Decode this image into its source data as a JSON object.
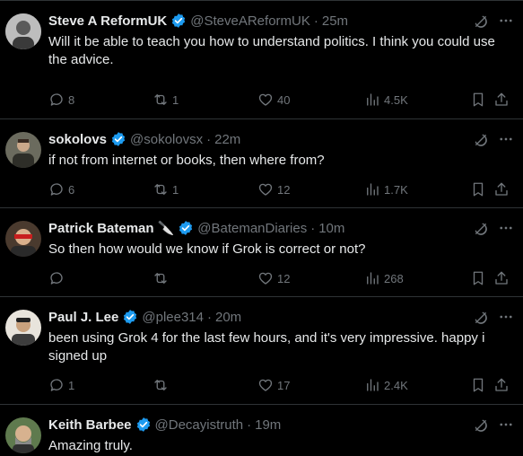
{
  "colors": {
    "background": "#000000",
    "text": "#e7e9ea",
    "muted": "#71767b",
    "verified": "#1d9bf0",
    "divider": "#2f3336"
  },
  "tweets": [
    {
      "name": "Steve A ReformUK",
      "handle": "@SteveAReformUK",
      "time": "25m",
      "text": "Will it be able to teach you how to understand politics. I think you could use the advice.",
      "replies": "8",
      "reposts": "1",
      "likes": "40",
      "views": "4.5K"
    },
    {
      "name": "sokolovs",
      "handle": "@sokolovsx",
      "time": "22m",
      "text": "if not from internet or books, then where from?",
      "replies": "6",
      "reposts": "1",
      "likes": "12",
      "views": "1.7K"
    },
    {
      "name": "Patrick Bateman",
      "name_emoji": "🔪",
      "handle": "@BatemanDiaries",
      "time": "10m",
      "text": "So then how would we know if Grok is correct or not?",
      "replies": "",
      "reposts": "",
      "likes": "12",
      "views": "268"
    },
    {
      "name": "Paul J. Lee",
      "handle": "@plee314",
      "time": "20m",
      "text": "been using Grok 4 for the last few hours, and it's very impressive.  happy i signed up",
      "replies": "1",
      "reposts": "",
      "likes": "17",
      "views": "2.4K"
    },
    {
      "name": "Keith Barbee",
      "handle": "@Decayistruth",
      "time": "19m",
      "text": "Amazing truly.",
      "replies": "",
      "reposts": "",
      "likes": "",
      "views": ""
    }
  ],
  "icons": {
    "verified": "verified-badge-icon",
    "grok": "grok-explain-icon",
    "more": "more-icon",
    "reply": "reply-icon",
    "repost": "repost-icon",
    "like": "heart-icon",
    "views": "views-icon",
    "bookmark": "bookmark-icon",
    "share": "share-icon"
  }
}
